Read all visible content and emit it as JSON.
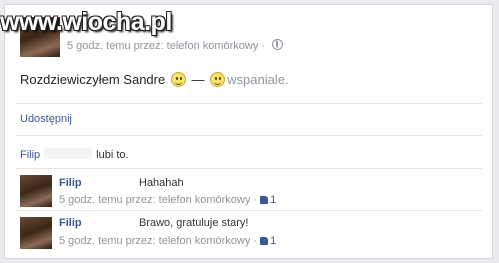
{
  "watermark": "www.wiocha.pl",
  "post": {
    "meta": "5 godz. temu przez: telefon komórkowy ·",
    "text": "Rozdziewiczyłem Sandre",
    "dash": "—",
    "feeling": "wspaniale."
  },
  "actions": {
    "share": "Udostępnij"
  },
  "likes": {
    "name": "Filip",
    "suffix": "lubi to."
  },
  "comments": [
    {
      "author": "Filip",
      "text": "Hahahah",
      "meta": "5 godz. temu przez: telefon komórkowy ·",
      "like_count": "1"
    },
    {
      "author": "Filip",
      "text": "Brawo, gratuluje stary!",
      "meta": "5 godz. temu przez: telefon komórkowy ·",
      "like_count": "1"
    }
  ],
  "icons": {
    "privacy": "globe-icon",
    "emoji": "smiley-icon",
    "like": "thumbs-up-icon"
  }
}
